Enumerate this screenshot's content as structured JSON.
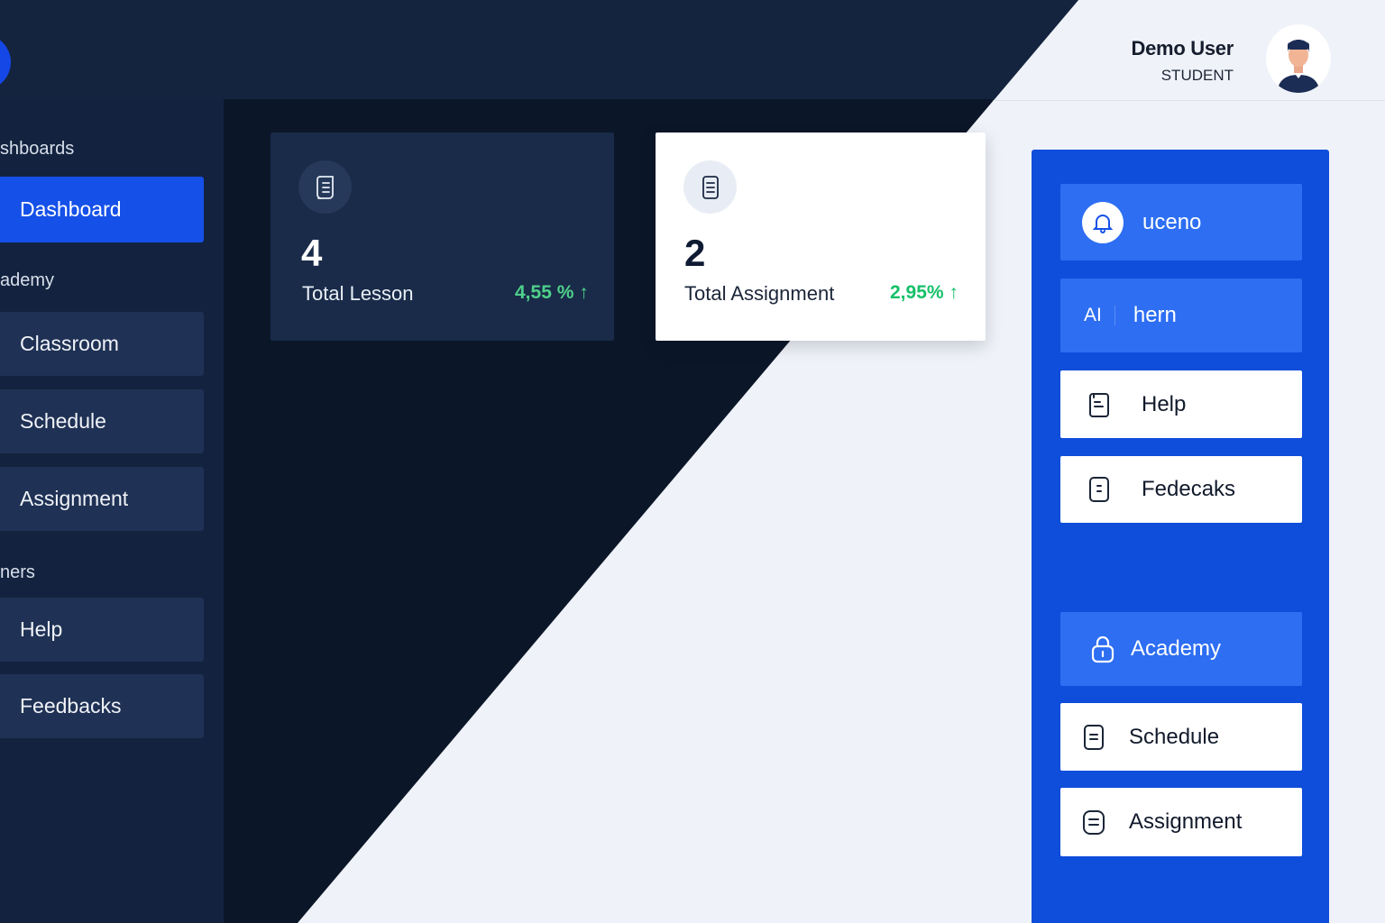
{
  "header": {
    "user_name": "Demo User",
    "user_role": "STUDENT"
  },
  "sidebar": {
    "sections": [
      {
        "label": "shboards"
      },
      {
        "label": "ademy"
      },
      {
        "label": "ners"
      }
    ],
    "items": [
      {
        "label": "Dashboard",
        "active": true
      },
      {
        "label": "Classroom"
      },
      {
        "label": "Schedule"
      },
      {
        "label": "Assignment"
      },
      {
        "label": "Help"
      },
      {
        "label": "Feedbacks"
      }
    ]
  },
  "cards": [
    {
      "value": "4",
      "label": "Total Lesson",
      "change": "4,55 % ↑",
      "icon": "document-icon"
    },
    {
      "value": "2",
      "label": "Total Assignment",
      "change": "2,95% ↑",
      "icon": "document-icon"
    }
  ],
  "right_panel": {
    "items": [
      {
        "label": "uceno",
        "icon": "bell-icon"
      },
      {
        "prefix": "AI",
        "label": "hern"
      },
      {
        "label": "Help",
        "icon": "document-icon"
      },
      {
        "label": "Fedecaks",
        "icon": "document-icon"
      },
      {
        "label": "Academy",
        "icon": "lock-icon"
      },
      {
        "label": "Schedule",
        "icon": "document-icon"
      },
      {
        "label": "Assignment",
        "icon": "document-icon"
      }
    ]
  },
  "colors": {
    "accent": "#1550e8",
    "positive": "#16c06a",
    "dark_bg": "#0b1628",
    "panel_blue": "#0f4ddb"
  }
}
